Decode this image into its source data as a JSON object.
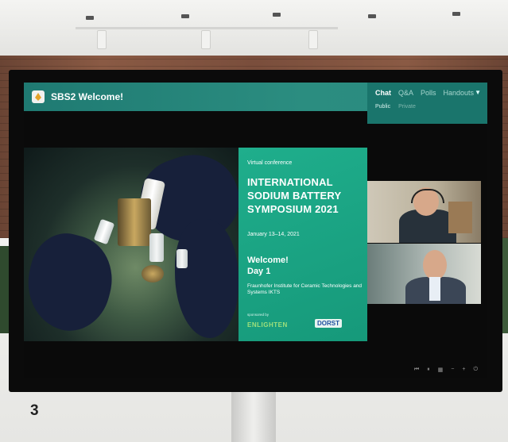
{
  "app": {
    "window_title": "SBS2 Welcome!"
  },
  "side_panel": {
    "tabs": [
      {
        "label": "Chat",
        "active": true
      },
      {
        "label": "Q&A",
        "active": false
      },
      {
        "label": "Polls",
        "active": false
      },
      {
        "label": "Handouts",
        "active": false
      }
    ],
    "dropdown_icon": "chevron-down-icon",
    "subtabs": [
      {
        "label": "Public",
        "active": true
      },
      {
        "label": "Private",
        "active": false
      }
    ]
  },
  "slide": {
    "kicker": "Virtual conference",
    "headline": "INTERNATIONAL SODIUM BATTERY SYMPOSIUM 2021",
    "dates": "January 13–14, 2021",
    "welcome_line1": "Welcome!",
    "welcome_line2": "Day 1",
    "institute": "Fraunhofer Institute for Ceramic Technologies and Systems IKTS",
    "sponsored_label": "sponsored by",
    "sponsor1": "ENLIGHTEN",
    "sponsor2": "DORST"
  },
  "participants": [
    {
      "name": "participant-1"
    },
    {
      "name": "participant-2"
    }
  ],
  "controls": [
    {
      "icon": "previous-icon",
      "glyph": "⏮"
    },
    {
      "icon": "pause-icon",
      "glyph": "⏸"
    },
    {
      "icon": "grid-icon",
      "glyph": "▦"
    },
    {
      "icon": "minus-icon",
      "glyph": "−"
    },
    {
      "icon": "plus-icon",
      "glyph": "+"
    },
    {
      "icon": "power-icon",
      "glyph": "⏻"
    }
  ],
  "figure_number": "3",
  "colors": {
    "accent": "#2b8d80",
    "slide_green": "#1fae8c",
    "sponsor_blue": "#1f4fa0"
  }
}
